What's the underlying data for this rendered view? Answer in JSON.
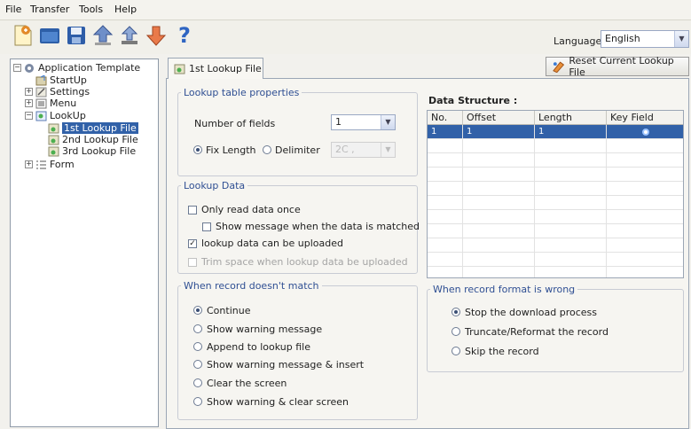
{
  "menu": [
    "File",
    "Transfer",
    "Tools",
    "Help"
  ],
  "toolbar": {
    "buttons": [
      "new-file-icon",
      "open-folder-icon",
      "save-icon",
      "upload-icon",
      "download-icon",
      "transfer-icon",
      "help-icon"
    ],
    "help_glyph": "?"
  },
  "language": {
    "label": "Language",
    "value": "English"
  },
  "tree": {
    "items": [
      {
        "label": "Application Template",
        "expander": "⊟"
      },
      {
        "label": "StartUp"
      },
      {
        "label": "Settings",
        "expander": "+"
      },
      {
        "label": "Menu",
        "expander": "+"
      },
      {
        "label": "LookUp",
        "expander": "−"
      },
      {
        "label": "1st Lookup File",
        "selected": true
      },
      {
        "label": "2nd Lookup File"
      },
      {
        "label": "3rd Lookup File"
      },
      {
        "label": "Form",
        "expander": "+"
      }
    ]
  },
  "tab": {
    "label": "1st Lookup File"
  },
  "reset_button": {
    "label": "Reset Current Lookup File"
  },
  "lookup_props": {
    "legend": "Lookup table properties",
    "fields_label": "Number of fields",
    "fields_value": "1",
    "fix_length_label": "Fix Length",
    "delimiter_label": "Delimiter",
    "delimiter_value": "2C ,",
    "mode": "fix_length"
  },
  "lookup_data": {
    "legend": "Lookup Data",
    "only_read_once": {
      "label": "Only read data once",
      "checked": false
    },
    "show_message": {
      "label": "Show message when the data is matched",
      "checked": false
    },
    "can_upload": {
      "label": "lookup data can be uploaded",
      "checked": true,
      "check_glyph": "✓"
    },
    "trim_space": {
      "label": "Trim space when lookup data be uploaded",
      "checked": false,
      "disabled": true
    }
  },
  "no_match": {
    "legend": "When record doesn't match",
    "options": [
      "Continue",
      "Show warning message",
      "Append to lookup file",
      "Show warning message & insert",
      "Clear the screen",
      "Show warning & clear screen"
    ],
    "selected": 0
  },
  "data_structure": {
    "title": "Data Structure :",
    "columns": [
      "No.",
      "Offset",
      "Length",
      "Key Field"
    ],
    "rows": [
      {
        "no": "1",
        "offset": "1",
        "length": "1",
        "key_field": true
      }
    ]
  },
  "wrong_format": {
    "legend": "When record format is wrong",
    "options": [
      "Stop the download process",
      "Truncate/Reformat the record",
      "Skip the record"
    ],
    "selected": 0
  },
  "colors": {
    "accent": "#3161a8",
    "legend": "#2f4f93"
  },
  "select_arrow": "▼"
}
